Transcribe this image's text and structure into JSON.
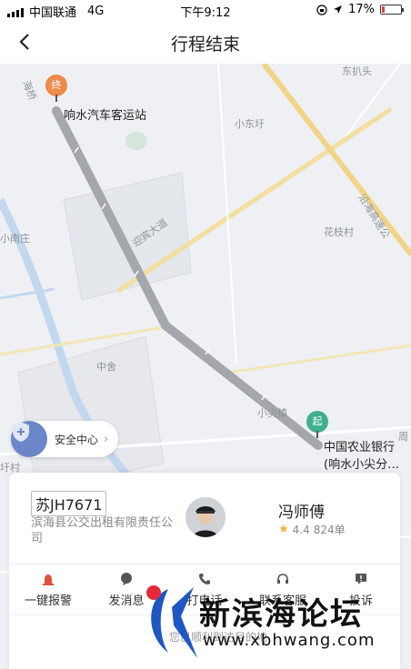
{
  "status_bar": {
    "carrier": "中国联通",
    "network": "4G",
    "time": "下午9:12",
    "battery": "17%",
    "battery_level": 0.17
  },
  "nav": {
    "back_icon": "chevron-left-icon",
    "title": "行程结束"
  },
  "map": {
    "labels": {
      "dongpi": "东扒头",
      "xiaodong": "小东圩",
      "yanhai": "沿海高速公",
      "yingbin": "迎宾大道",
      "huazhi": "花枝村",
      "xiaonan": "小南庄",
      "zhongshe": "中舍",
      "xiaojian": "小尖镇",
      "zhou": "周",
      "haiqiao": "海桥",
      "tuxu": "圩村"
    },
    "end_pin": "终",
    "end_place": "响水汽车客运站",
    "start_pin": "起",
    "start_place_line1": "中国农业银行",
    "start_place_line2": "(响水小尖分…",
    "safety_center": "安全中心"
  },
  "driver_card": {
    "plate": "苏JH7671",
    "company": "滨海县公交出租有限责任公司",
    "driver_name": "冯师傅",
    "rating": "4.4",
    "orders": "824单",
    "actions": [
      {
        "label": "一键报警",
        "icon": "alarm-icon"
      },
      {
        "label": "发消息",
        "icon": "message-icon"
      },
      {
        "label": "打电话",
        "icon": "phone-icon"
      },
      {
        "label": "联系客服",
        "icon": "headset-icon"
      },
      {
        "label": "投诉",
        "icon": "complaint-icon"
      }
    ],
    "notice": "您已顺利到达目的地"
  },
  "watermark": {
    "title": "新滨海论坛",
    "url": "www.xbhwang.com"
  },
  "colors": {
    "route": "#a4a7ab",
    "end_pin": "#ef8a4a",
    "start_pin": "#3fb08d",
    "alarm": "#e0523a",
    "star": "#f5b23c"
  }
}
